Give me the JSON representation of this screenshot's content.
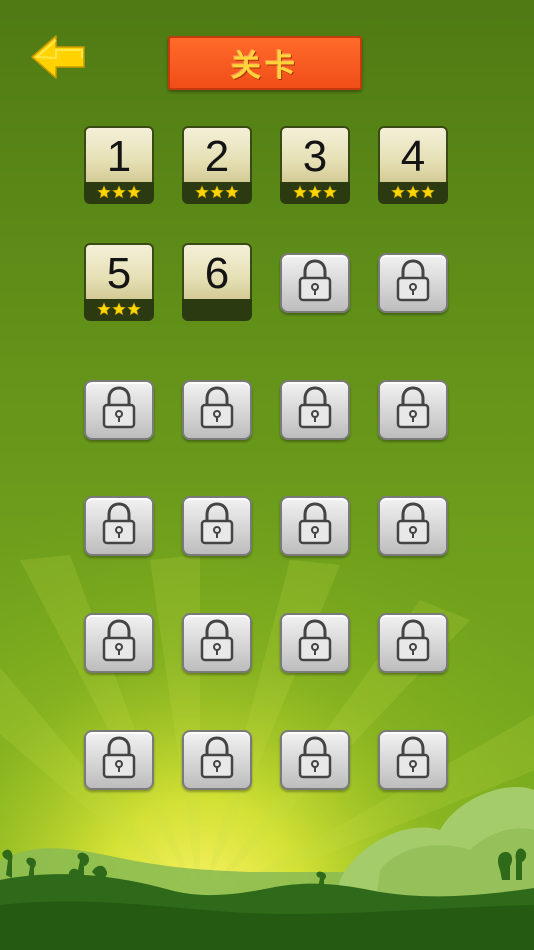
{
  "header": {
    "title": "关卡",
    "back_icon": "arrow-left-icon"
  },
  "colors": {
    "background": "#5f8e18",
    "banner": "#f04e17",
    "banner_text": "#ffd33a",
    "star": "#ffd700",
    "back_arrow": "#ffd200"
  },
  "levels": [
    {
      "label": "1",
      "unlocked": true,
      "stars": 3
    },
    {
      "label": "2",
      "unlocked": true,
      "stars": 3
    },
    {
      "label": "3",
      "unlocked": true,
      "stars": 3
    },
    {
      "label": "4",
      "unlocked": true,
      "stars": 3
    },
    {
      "label": "5",
      "unlocked": true,
      "stars": 3
    },
    {
      "label": "6",
      "unlocked": true,
      "stars": 0
    },
    {
      "label": "",
      "unlocked": false,
      "stars": 0
    },
    {
      "label": "",
      "unlocked": false,
      "stars": 0
    },
    {
      "label": "",
      "unlocked": false,
      "stars": 0
    },
    {
      "label": "",
      "unlocked": false,
      "stars": 0
    },
    {
      "label": "",
      "unlocked": false,
      "stars": 0
    },
    {
      "label": "",
      "unlocked": false,
      "stars": 0
    },
    {
      "label": "",
      "unlocked": false,
      "stars": 0
    },
    {
      "label": "",
      "unlocked": false,
      "stars": 0
    },
    {
      "label": "",
      "unlocked": false,
      "stars": 0
    },
    {
      "label": "",
      "unlocked": false,
      "stars": 0
    },
    {
      "label": "",
      "unlocked": false,
      "stars": 0
    },
    {
      "label": "",
      "unlocked": false,
      "stars": 0
    },
    {
      "label": "",
      "unlocked": false,
      "stars": 0
    },
    {
      "label": "",
      "unlocked": false,
      "stars": 0
    },
    {
      "label": "",
      "unlocked": false,
      "stars": 0
    },
    {
      "label": "",
      "unlocked": false,
      "stars": 0
    },
    {
      "label": "",
      "unlocked": false,
      "stars": 0
    },
    {
      "label": "",
      "unlocked": false,
      "stars": 0
    }
  ],
  "level_icons": {
    "locked": "padlock-icon",
    "star": "star-icon"
  }
}
